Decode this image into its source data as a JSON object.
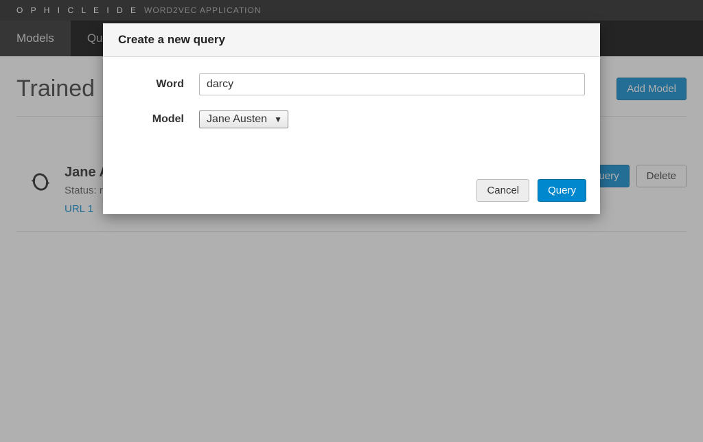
{
  "header": {
    "brand": "O P H I C L E I D E",
    "subtitle": "WORD2VEC APPLICATION"
  },
  "nav": {
    "models": "Models",
    "queries": "Queries"
  },
  "page": {
    "title": "Trained Models",
    "add_model": "Add Model"
  },
  "model": {
    "name": "Jane Austen",
    "status": "Status: ready",
    "url": "URL 1",
    "new_query": "New Query",
    "delete": "Delete"
  },
  "modal": {
    "title": "Create a new query",
    "word_label": "Word",
    "word_value": "darcy",
    "model_label": "Model",
    "model_selected": "Jane Austen",
    "cancel": "Cancel",
    "query": "Query"
  }
}
